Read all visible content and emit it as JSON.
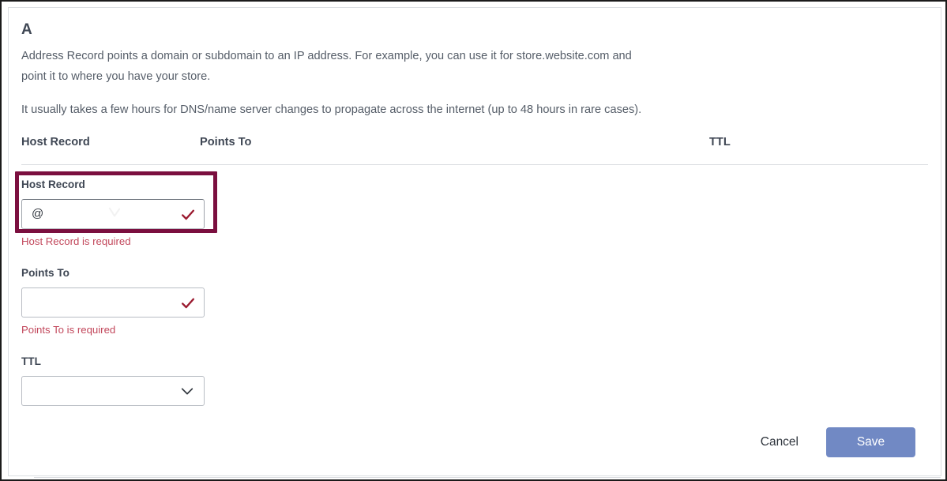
{
  "record": {
    "type_title": "A",
    "description_line1": "Address Record points a domain or subdomain to an IP address. For example, you can use it for store.website.com and",
    "description_line2": "point it to where you have your store.",
    "propagation_note": "It usually takes a few hours for DNS/name server changes to propagate across the internet (up to 48 hours in rare cases)."
  },
  "table": {
    "columns": [
      {
        "key": "host_record",
        "label": "Host Record"
      },
      {
        "key": "points_to",
        "label": "Points To"
      },
      {
        "key": "ttl",
        "label": "TTL"
      }
    ]
  },
  "form": {
    "host_record": {
      "label": "Host Record",
      "value": "@",
      "placeholder": "",
      "error": "Host Record is required",
      "valid_icon": "check-icon",
      "highlighted": true
    },
    "points_to": {
      "label": "Points To",
      "value": "",
      "placeholder": "",
      "error": "Points To is required",
      "valid_icon": "check-icon"
    },
    "ttl": {
      "label": "TTL",
      "value": "",
      "placeholder": "",
      "dropdown_icon": "chevron-down-icon"
    }
  },
  "actions": {
    "cancel_label": "Cancel",
    "save_label": "Save"
  },
  "colors": {
    "highlight_border": "#7b0f3f",
    "error_text": "#c2475b",
    "check_icon": "#9b1b30",
    "save_button": "#7189c4",
    "heading_text": "#3f4754",
    "body_text": "#555d68",
    "divider": "#d9dce0"
  }
}
